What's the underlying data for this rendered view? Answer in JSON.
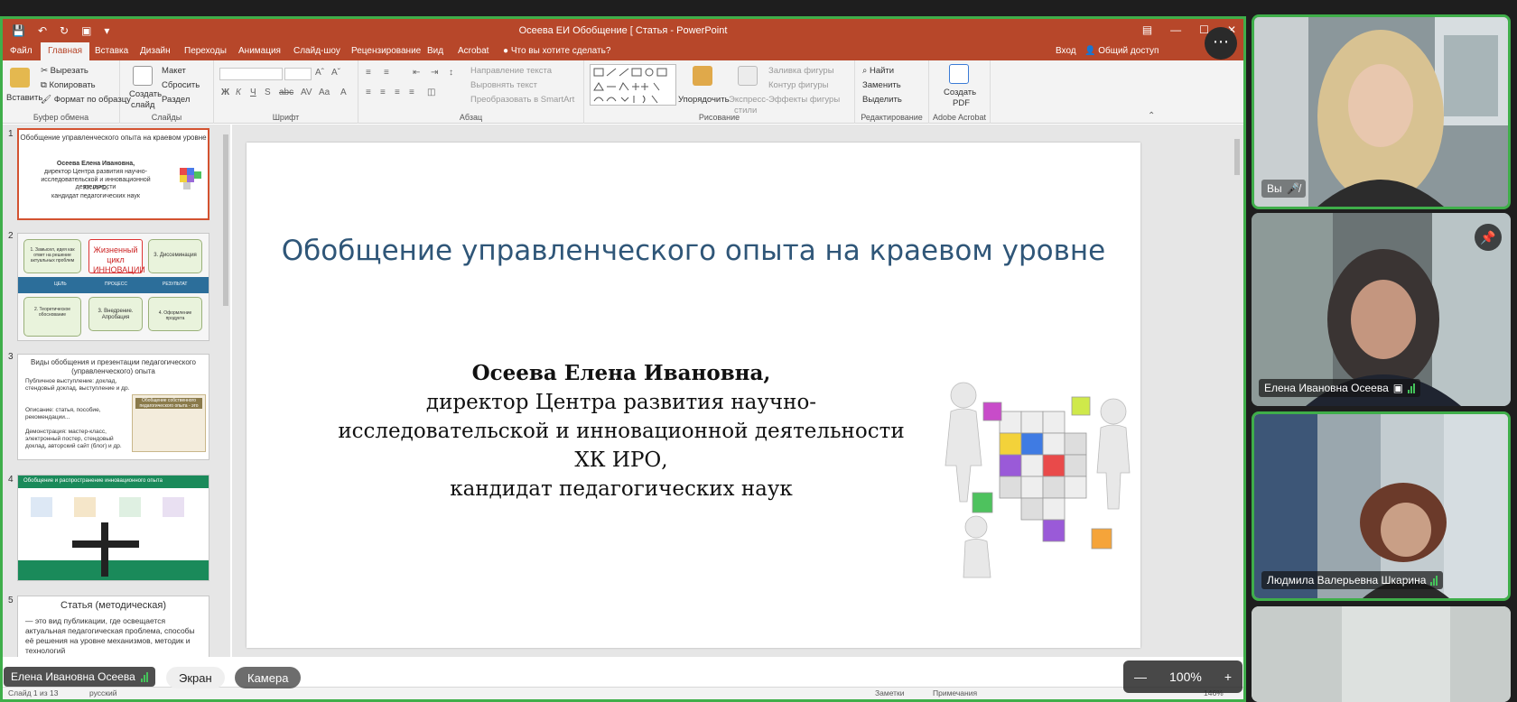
{
  "powerpoint": {
    "window_title": "Осеева ЕИ  Обобщение [ Статья - PowerPoint",
    "tabs": [
      "Файл",
      "Главная",
      "Вставка",
      "Дизайн",
      "Переходы",
      "Анимация",
      "Слайд-шоу",
      "Рецензирование",
      "Вид",
      "Acrobat"
    ],
    "tellme": "Что вы хотите сделать?",
    "signin": "Вход",
    "share": "Общий доступ",
    "ribbon": {
      "paste": "Вставить",
      "cut": "Вырезать",
      "copy": "Копировать",
      "format_painter": "Формат по образцу",
      "clipboard": "Буфер обмена",
      "new_slide_1": "Создать",
      "new_slide_2": "слайд",
      "layout": "Макет",
      "reset": "Сбросить",
      "section": "Раздел",
      "slides": "Слайды",
      "font_group": "Шрифт",
      "text_direction": "Направление текста",
      "align_text": "Выровнять текст",
      "smartart": "Преобразовать в SmartArt",
      "paragraph": "Абзац",
      "arrange": "Упорядочить",
      "quick_styles_1": "Экспресс-",
      "quick_styles_2": "стили",
      "shape_fill": "Заливка фигуры",
      "shape_outline": "Контур фигуры",
      "shape_effects": "Эффекты фигуры",
      "drawing": "Рисование",
      "find": "Найти",
      "replace": "Заменить",
      "select": "Выделить",
      "editing": "Редактирование",
      "create_pdf_1": "Создать",
      "create_pdf_2": "PDF",
      "acrobat": "Adobe Acrobat"
    },
    "thumbnails": [
      {
        "num": "1",
        "title": "Обобщение управленческого опыта на краевом уровне",
        "lines": [
          "Осеева  Елена Ивановна,",
          "директор Центра развития научно-",
          "исследовательской и инновационной деятельности",
          "ХК ИРО,",
          "кандидат педагогических наук"
        ]
      },
      {
        "num": "2",
        "center": "Жизненный цикл ИННОВАЦИИ",
        "box_a": "1. Замысел, идея как ответ на решение актуальных проблем",
        "box_b": "3. Диссеминация",
        "box_c": "2. Теоретическое обоснование",
        "box_d": "3. Внедрение. Апробация",
        "box_e": "4. Оформление продукта",
        "band": [
          "ЦЕЛЬ",
          "ПРОЦЕСС",
          "РЕЗУЛЬТАТ"
        ]
      },
      {
        "num": "3",
        "title": "Виды обобщения и презентации педагогического (управленческого)  опыта",
        "l1": "Публичное выступление: доклад, стендовый доклад, выступление и др.",
        "l2": "Описание: статья, пособие, рекомендации...",
        "l3": "Демонстрация: мастер-класс, электронный постер, стендовый доклад, авторский сайт (блог) и др.",
        "side": "Обобщение собственного педагогического опыта - это"
      },
      {
        "num": "4",
        "title": "Обобщение и распространение инновационного опыта"
      },
      {
        "num": "5",
        "title": "Статья  (методическая)",
        "body": "— это вид публикации, где освещается актуальная педагогическая проблема, способы её решения на уровне механизмов, методик и технологий"
      }
    ],
    "slide": {
      "title": "Обобщение управленческого опыта на краевом уровне",
      "name": "Осеева  Елена Ивановна,",
      "line2": "директор Центра развития научно-",
      "line3": "исследовательской и инновационной деятельности",
      "line4": "ХК ИРО,",
      "line5": "кандидат педагогических наук"
    },
    "status": {
      "slide_count": "Слайд 1 из 13",
      "language": "русский",
      "notes": "Заметки",
      "comments": "Примечания",
      "zoom": "146%"
    }
  },
  "meeting": {
    "presenter_label": "Елена Ивановна Осеева",
    "tab_screen": "Экран",
    "tab_camera": "Камера",
    "zoom_value": "100%",
    "participants": [
      {
        "name": "Вы",
        "active": true
      },
      {
        "name": "Елена Ивановна Осеева",
        "active": false
      },
      {
        "name": "Людмила Валерьевна Шкарина",
        "active": true
      },
      {
        "name": "",
        "active": false
      }
    ]
  },
  "colors": {
    "ppt_red": "#b7472a",
    "active_green": "#3fae4a",
    "title_blue": "#2f5678"
  }
}
